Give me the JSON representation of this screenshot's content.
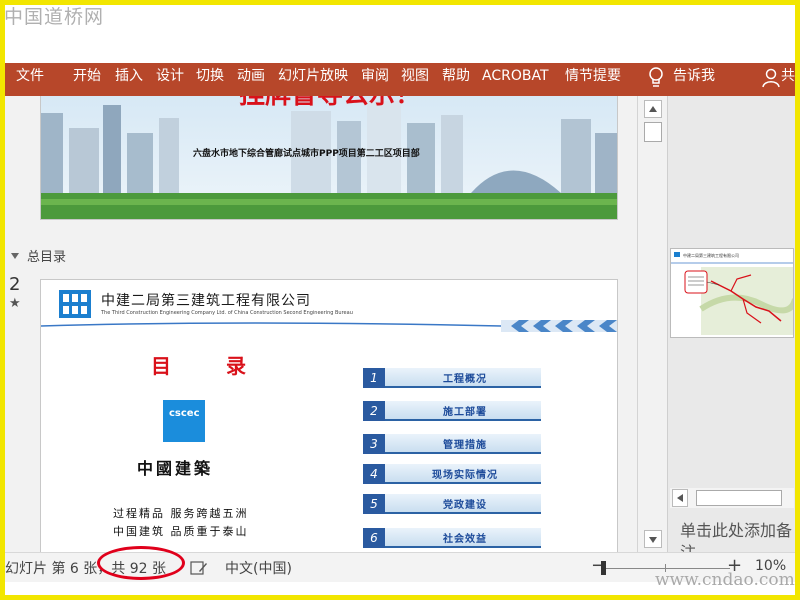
{
  "watermark_top": "中国道桥网",
  "watermark_bottom": "www.cndao.com",
  "ribbon": {
    "tabs": [
      "文件",
      "开始",
      "插入",
      "设计",
      "切换",
      "动画",
      "幻灯片放映",
      "审阅",
      "视图",
      "帮助",
      "ACROBAT",
      "情节提要"
    ],
    "tell_me": "告诉我",
    "share": "共",
    "color": "#b7472a"
  },
  "slide_a": {
    "heading_partial": "挂牌督导公示！",
    "subtitle": "六盘水市地下综合管廊试点城市PPP项目第二工区项目部"
  },
  "section": {
    "name": "总目录"
  },
  "slide_b": {
    "number": "2",
    "star": "★",
    "company": "中建二局第三建筑工程有限公司",
    "company_en": "The Third Construction Engineering Company Ltd. of China Construction Second Engineering Bureau",
    "logo_text": "cscec",
    "title": "目  录",
    "brand": "中國建築",
    "motto1": "过程精品  服务跨越五洲",
    "motto2": "中国建筑  品质重于泰山",
    "toc": [
      {
        "num": "1",
        "label": "工程概况"
      },
      {
        "num": "2",
        "label": "施工部署"
      },
      {
        "num": "3",
        "label": "管理措施"
      },
      {
        "num": "4",
        "label": "现场实际情况"
      },
      {
        "num": "5",
        "label": "党政建设"
      },
      {
        "num": "6",
        "label": "社会效益"
      }
    ]
  },
  "thumbnail": {
    "header": "中建二局第三建筑工程有限公司"
  },
  "notes_placeholder": "单击此处添加备注",
  "status": {
    "slide_info": "幻灯片 第 6 张，共 92 张",
    "language": "中文(中国)",
    "zoom": "10%",
    "minus": "−",
    "plus": "+"
  }
}
